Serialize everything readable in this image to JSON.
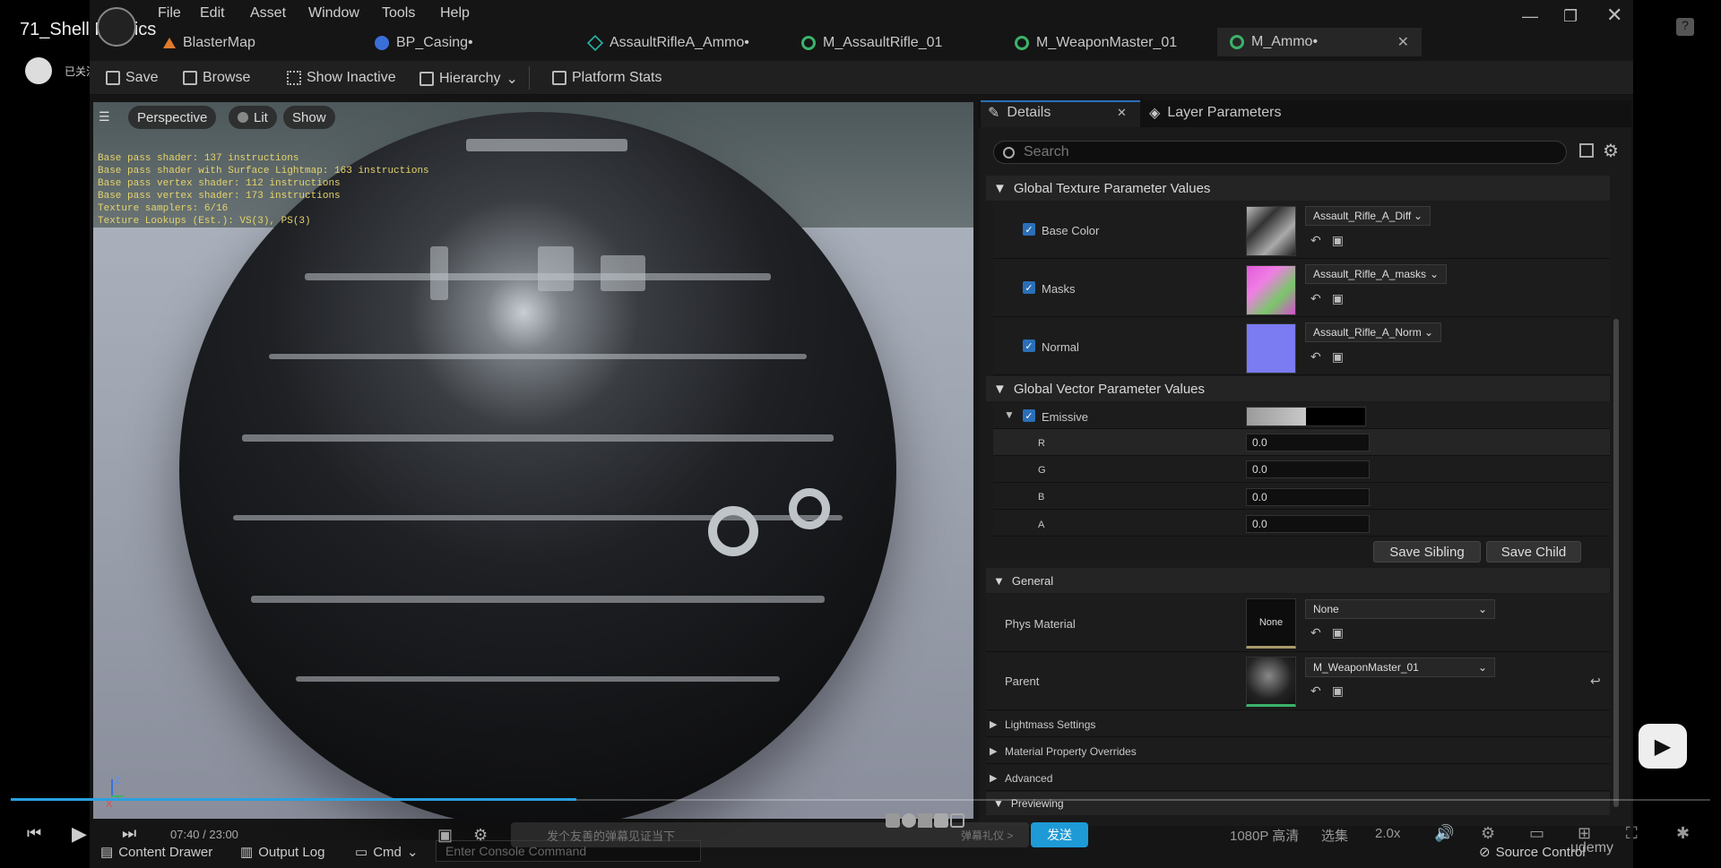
{
  "video": {
    "title": "71_Shell Physics",
    "follow": "已关注",
    "time": "07:40 / 23:00",
    "danmaku_placeholder": "发个友善的弹幕见证当下",
    "danmaku_gift": "弹幕礼仪 >",
    "send": "发送",
    "quality": "1080P 高清",
    "episodes": "选集",
    "speed": "2.0x",
    "progress": 0.333
  },
  "menu": [
    "File",
    "Edit",
    "Asset",
    "Window",
    "Tools",
    "Help"
  ],
  "tabs": [
    {
      "label": "BlasterMap",
      "color": "#e07a2a"
    },
    {
      "label": "BP_Casing•",
      "color": "#3a6fd8"
    },
    {
      "label": "AssaultRifleA_Ammo•",
      "color": "#2bb5a8"
    },
    {
      "label": "M_AssaultRifle_01",
      "color": "#3bb36a"
    },
    {
      "label": "M_WeaponMaster_01",
      "color": "#3bb36a"
    },
    {
      "label": "M_Ammo•",
      "color": "#3bb36a"
    }
  ],
  "toolbar": {
    "save": "Save",
    "browse": "Browse",
    "show_inactive": "Show Inactive",
    "hierarchy": "Hierarchy",
    "platform_stats": "Platform Stats"
  },
  "viewport": {
    "perspective": "Perspective",
    "lit": "Lit",
    "show": "Show",
    "stats": [
      "Base pass shader: 137 instructions",
      "Base pass shader with Surface Lightmap: 163 instructions",
      "Base pass vertex shader: 112 instructions",
      "Base pass vertex shader: 173 instructions",
      "Texture samplers: 6/16",
      "Texture Lookups (Est.): VS(3), PS(3)"
    ]
  },
  "details": {
    "tab_details": "Details",
    "tab_layer": "Layer Parameters",
    "search_placeholder": "Search",
    "sec_texture": "Global Texture Parameter Values",
    "sec_vector": "Global Vector Parameter Values",
    "sec_general": "General",
    "sec_previewing": "Previewing",
    "base_color": {
      "label": "Base Color",
      "value": "Assault_Rifle_A_Diff"
    },
    "masks": {
      "label": "Masks",
      "value": "Assault_Rifle_A_masks"
    },
    "normal": {
      "label": "Normal",
      "value": "Assault_Rifle_A_Norm"
    },
    "emissive": "Emissive",
    "channels": [
      {
        "label": "R",
        "value": "0.0"
      },
      {
        "label": "G",
        "value": "0.0"
      },
      {
        "label": "B",
        "value": "0.0"
      },
      {
        "label": "A",
        "value": "0.0"
      }
    ],
    "save_sibling": "Save Sibling",
    "save_child": "Save Child",
    "phys_material": {
      "label": "Phys Material",
      "thumb": "None",
      "value": "None"
    },
    "parent": {
      "label": "Parent",
      "value": "M_WeaponMaster_01"
    },
    "collapsed": [
      "Lightmass Settings",
      "Material Property Overrides",
      "Advanced"
    ]
  },
  "bottom": {
    "content_drawer": "Content Drawer",
    "output_log": "Output Log",
    "cmd": "Cmd",
    "console_placeholder": "Enter Console Command",
    "source_control": "Source Control",
    "udemy": "udemy"
  }
}
